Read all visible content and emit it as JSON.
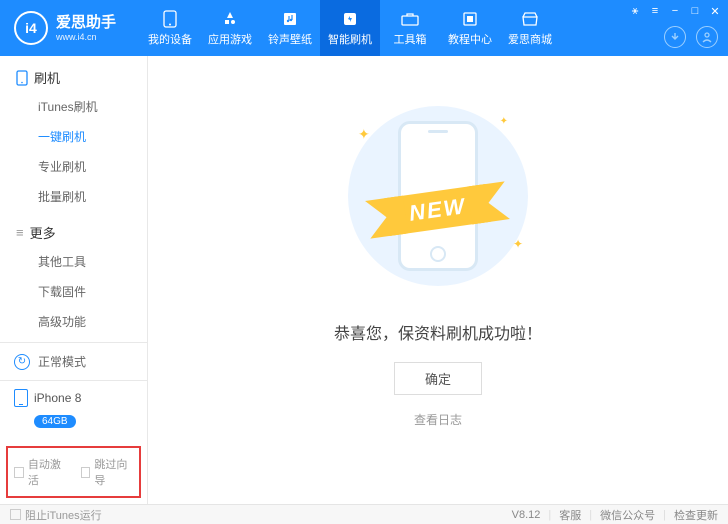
{
  "brand": {
    "title": "爱思助手",
    "subtitle": "www.i4.cn",
    "logo_text": "i4"
  },
  "win": {
    "cart": "⚹",
    "menu": "≡",
    "min": "−",
    "max": "□",
    "close": "✕"
  },
  "nav": [
    {
      "label": "我的设备",
      "icon": "phone"
    },
    {
      "label": "应用游戏",
      "icon": "apps"
    },
    {
      "label": "铃声壁纸",
      "icon": "music"
    },
    {
      "label": "智能刷机",
      "icon": "flash",
      "active": true
    },
    {
      "label": "工具箱",
      "icon": "toolbox"
    },
    {
      "label": "教程中心",
      "icon": "book"
    },
    {
      "label": "爱思商城",
      "icon": "shop"
    }
  ],
  "sidebar": {
    "section1": {
      "title": "刷机",
      "items": [
        "iTunes刷机",
        "一键刷机",
        "专业刷机",
        "批量刷机"
      ],
      "active_index": 1
    },
    "section2": {
      "title": "更多",
      "items": [
        "其他工具",
        "下载固件",
        "高级功能"
      ]
    },
    "mode": "正常模式",
    "device": {
      "name": "iPhone 8",
      "storage": "64GB"
    },
    "checks": {
      "auto_activate": "自动激活",
      "skip_guide": "跳过向导"
    }
  },
  "main": {
    "ribbon": "NEW",
    "success": "恭喜您，保资料刷机成功啦！",
    "ok": "确定",
    "log": "查看日志"
  },
  "footer": {
    "block_itunes": "阻止iTunes运行",
    "version": "V8.12",
    "support": "客服",
    "wechat": "微信公众号",
    "update": "检查更新"
  }
}
